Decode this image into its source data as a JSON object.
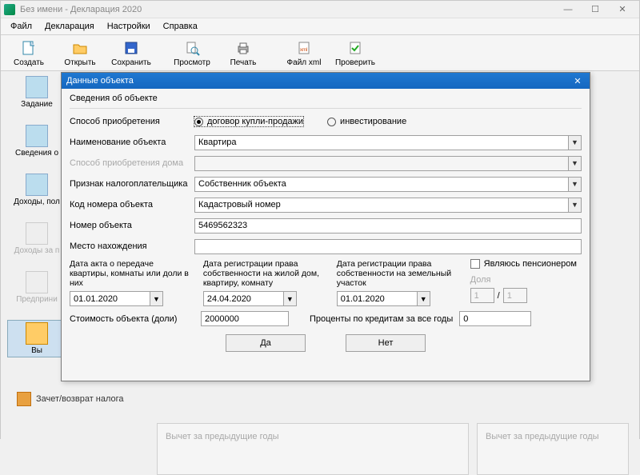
{
  "window": {
    "title": "Без имени - Декларация 2020"
  },
  "menu": {
    "file": "Файл",
    "decl": "Декларация",
    "settings": "Настройки",
    "help": "Справка"
  },
  "toolbar": {
    "create": "Создать",
    "open": "Открыть",
    "save": "Сохранить",
    "preview": "Просмотр",
    "print": "Печать",
    "xml": "Файл xml",
    "check": "Проверить"
  },
  "side": {
    "cond": "Задание",
    "info": "Сведения о",
    "inc": "Доходы, пол",
    "inc2": "Доходы за п",
    "pred": "Предприни",
    "vych": "Вы"
  },
  "section_label": "Зачет/возврат налога",
  "panel": {
    "prev": "Вычет за предыдущие годы"
  },
  "dialog": {
    "title": "Данные объекта",
    "group": "Сведения об объекте",
    "method_label": "Способ приобретения",
    "method_buy": "договор купли-продажи",
    "method_invest": "инвестирование",
    "name_label": "Наименование объекта",
    "name_value": "Квартира",
    "house_method": "Способ приобретения дома",
    "taxpayer_label": "Признак налогоплательщика",
    "taxpayer_value": "Собственник объекта",
    "code_label": "Код номера объекта",
    "code_value": "Кадастровый номер",
    "number_label": "Номер объекта",
    "number_value": "5469562323",
    "loc_label": "Место нахождения",
    "loc_value": "",
    "date1_label": "Дата акта о передаче квартиры, комнаты или доли в них",
    "date1_value": "01.01.2020",
    "date2_label": "Дата регистрации права собственности на жилой дом, квартиру, комнату",
    "date2_value": "24.04.2020",
    "date3_label": "Дата регистрации права собственности на земельный участок",
    "date3_value": "01.01.2020",
    "pension": "Являюсь пенсионером",
    "share_label": "Доля",
    "share_a": "1",
    "share_b": "1",
    "cost_label": "Стоимость объекта (доли)",
    "cost_value": "2000000",
    "credit_label": "Проценты по кредитам за все годы",
    "credit_value": "0",
    "yes": "Да",
    "no": "Нет"
  }
}
